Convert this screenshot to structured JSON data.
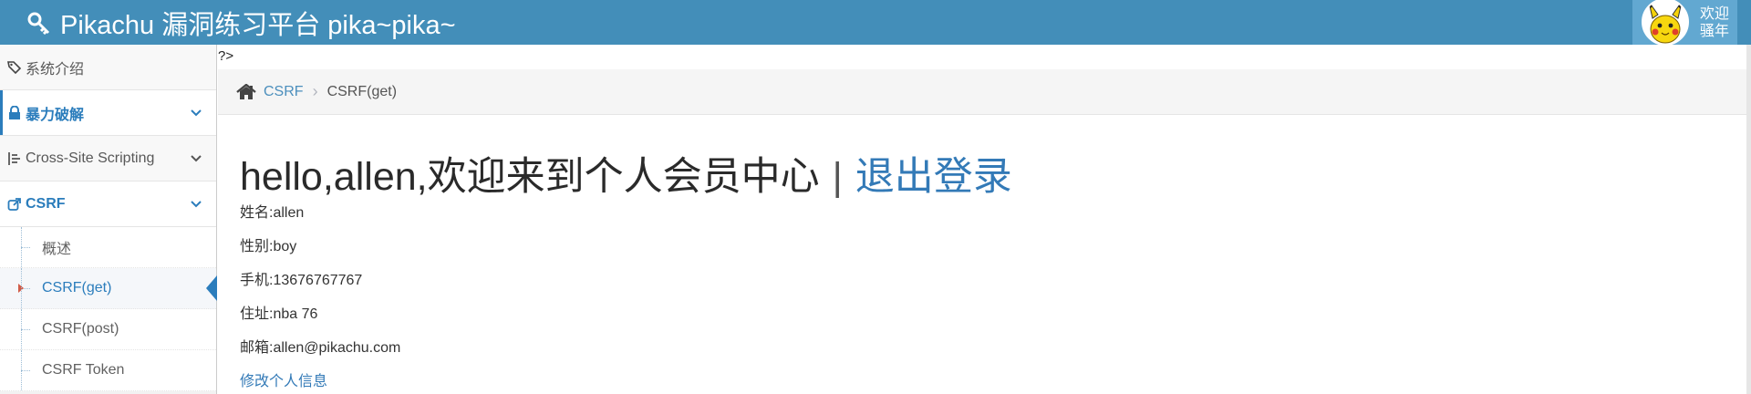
{
  "navbar": {
    "brand": "Pikachu 漏洞练习平台 pika~pika~",
    "greeting_line1": "欢迎",
    "greeting_line2": "骚年"
  },
  "sidebar": {
    "items": [
      {
        "label": "系统介绍",
        "icon": "tags-icon"
      },
      {
        "label": "暴力破解",
        "icon": "lock-icon"
      },
      {
        "label": "Cross-Site Scripting",
        "icon": "list-icon"
      },
      {
        "label": "CSRF",
        "icon": "share-icon"
      }
    ],
    "submenu": [
      {
        "label": "概述"
      },
      {
        "label": "CSRF(get)"
      },
      {
        "label": "CSRF(post)"
      },
      {
        "label": "CSRF Token"
      }
    ]
  },
  "main": {
    "stray_text": "?>",
    "breadcrumb": {
      "parent": "CSRF",
      "current": "CSRF(get)"
    },
    "heading": "hello,allen,欢迎来到个人会员中心",
    "heading_sep": "|",
    "logout": "退出登录",
    "profile": {
      "name": "姓名:allen",
      "sex": "性别:boy",
      "phone": "手机:13676767767",
      "address": "住址:nba 76",
      "email": "邮箱:allen@pikachu.com"
    },
    "edit_link": "修改个人信息"
  },
  "colors": {
    "navbar": "#438eb9",
    "accent": "#2b7dbc",
    "link": "#337ab7"
  }
}
